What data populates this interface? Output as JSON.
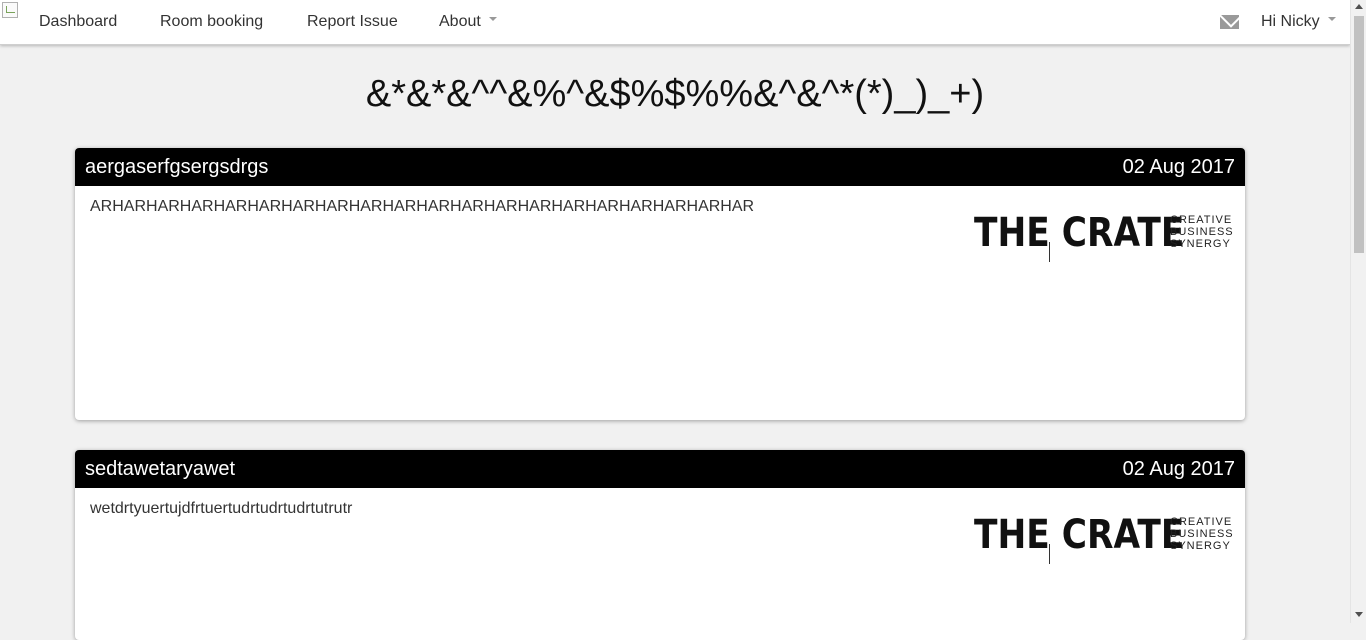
{
  "nav": {
    "items": [
      {
        "label": "Dashboard"
      },
      {
        "label": "Room booking"
      },
      {
        "label": "Report Issue"
      },
      {
        "label": "About"
      }
    ],
    "user_greeting": "Hi Nicky",
    "icons": {
      "mail": "envelope-icon",
      "logo_placeholder": "broken-image-icon"
    }
  },
  "page": {
    "title": "&*&*&^^&%^&$%$%%&^&^*(*)_)_+)"
  },
  "posts": [
    {
      "title": "aergaserfgsergsdrgs",
      "date": "02 Aug 2017",
      "body": "ARHARHARHARHARHARHARHARHARHARHARHARHARHARHARHARHARHARHARHAR",
      "logo": {
        "main": "THE CRATE",
        "tag": [
          "CREATIVE",
          "BUSINESS",
          "SYNERGY"
        ]
      }
    },
    {
      "title": "sedtawetaryawet",
      "date": "02 Aug 2017",
      "body": "wetdrtyuertujdfrtuertudrtudrtudrtutrutr",
      "logo": {
        "main": "THE CRATE",
        "tag": [
          "CREATIVE",
          "BUSINESS",
          "SYNERGY"
        ]
      }
    }
  ],
  "colors": {
    "background": "#f1f1f1",
    "navbar": "#ffffff",
    "card_header": "#000000",
    "card_body": "#ffffff"
  }
}
